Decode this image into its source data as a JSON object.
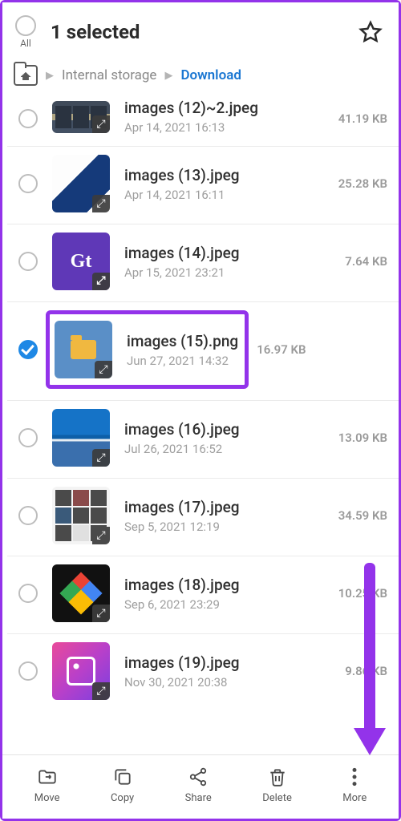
{
  "header": {
    "title": "1 selected",
    "all_label": "All"
  },
  "breadcrumb": {
    "internal": "Internal storage",
    "download": "Download"
  },
  "files": [
    {
      "name": "images (12)~2.jpeg",
      "date": "Apr 14, 2021 16:13",
      "size": "41.19 KB",
      "selected": false
    },
    {
      "name": "images (13).jpeg",
      "date": "Apr 14, 2021 16:11",
      "size": "25.28 KB",
      "selected": false
    },
    {
      "name": "images (14).jpeg",
      "date": "Apr 15, 2021 23:21",
      "size": "7.64 KB",
      "selected": false
    },
    {
      "name": "images (15).png",
      "date": "Jun 27, 2021 14:32",
      "size": "16.97 KB",
      "selected": true,
      "highlighted": true
    },
    {
      "name": "images (16).jpeg",
      "date": "Jul 26, 2021 16:52",
      "size": "13.09 KB",
      "selected": false
    },
    {
      "name": "images (17).jpeg",
      "date": "Sep 5, 2021 12:19",
      "size": "34.59 KB",
      "selected": false
    },
    {
      "name": "images (18).jpeg",
      "date": "Sep 6, 2021 23:29",
      "size": "10.25 KB",
      "selected": false
    },
    {
      "name": "images (19).jpeg",
      "date": "Nov 30, 2021 20:38",
      "size": "9.86 KB",
      "selected": false
    }
  ],
  "bottom": {
    "move": "Move",
    "copy": "Copy",
    "share": "Share",
    "delete": "Delete",
    "more": "More"
  }
}
